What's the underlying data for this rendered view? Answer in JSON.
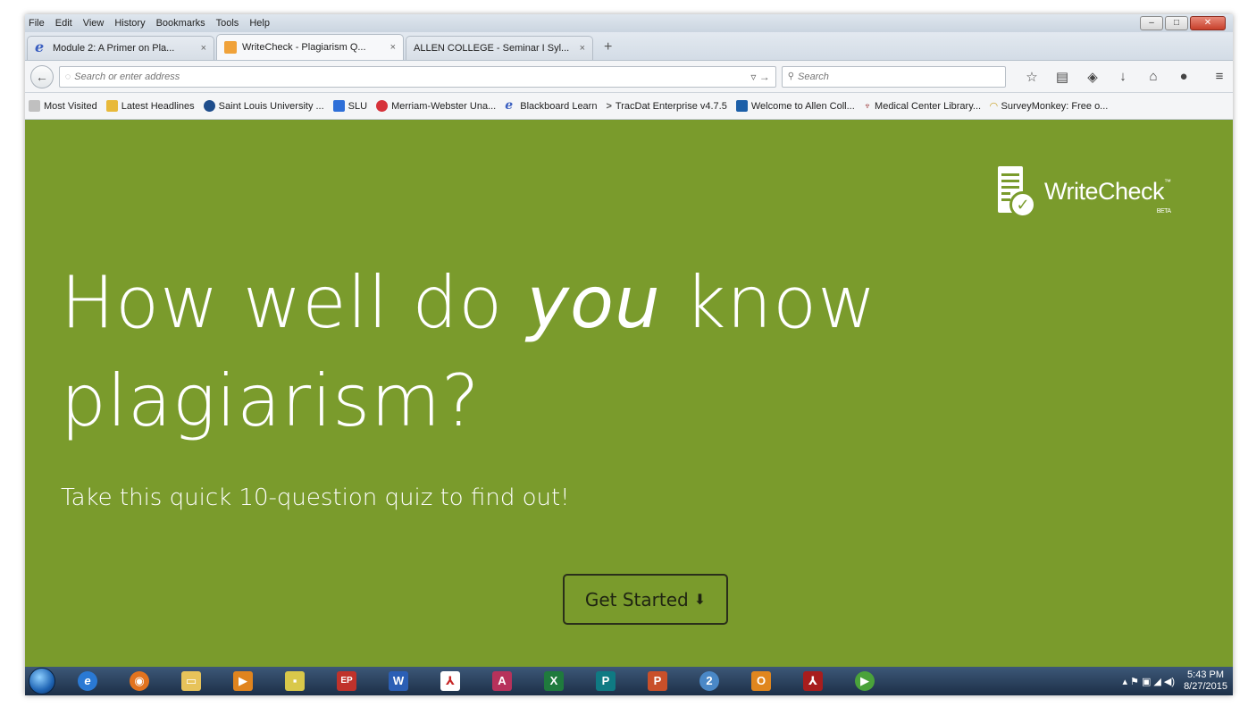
{
  "menubar": {
    "items": [
      "File",
      "Edit",
      "View",
      "History",
      "Bookmarks",
      "Tools",
      "Help"
    ]
  },
  "tabs": [
    {
      "label": "Module 2: A Primer on Pla...",
      "icon": "ie-icon"
    },
    {
      "label": "WriteCheck - Plagiarism Q...",
      "icon": "writecheck-icon"
    },
    {
      "label": "ALLEN COLLEGE - Seminar I Syl...",
      "icon": "none"
    }
  ],
  "newtab_label": "+",
  "tab_close": "×",
  "navbar": {
    "url_placeholder": "Search or enter address",
    "url_arrows": "▿ →",
    "search_placeholder": "Search",
    "search_glyph": "🔍"
  },
  "toolbar_icons": {
    "star": "☆",
    "reader": "▤",
    "pocket": "◈",
    "download": "↓",
    "home": "⌂",
    "chat": "●",
    "menu": "≡"
  },
  "bookmarks": [
    {
      "label": "Most Visited",
      "color": "#c0c0c0"
    },
    {
      "label": "Latest Headlines",
      "color": "#e8b93a"
    },
    {
      "label": "Saint Louis University ...",
      "color": "#1e4d8c"
    },
    {
      "label": "SLU",
      "color": "#2e6fd8"
    },
    {
      "label": "Merriam-Webster Una...",
      "color": "#d6323a"
    },
    {
      "label": "Blackboard Learn",
      "color": "#3b5fc0"
    },
    {
      "label": "TracDat Enterprise v4.7.5",
      "color": "#555555"
    },
    {
      "label": "Welcome to Allen Coll...",
      "color": "#1c5fa8"
    },
    {
      "label": "Medical Center Library...",
      "color": "#8c1b1b"
    },
    {
      "label": "SurveyMonkey: Free o...",
      "color": "#c9a227"
    }
  ],
  "page": {
    "logo_text": "WriteCheck",
    "logo_tm": "™",
    "logo_beta": "BETA",
    "headline_part1": "How well do ",
    "headline_em": "you",
    "headline_part2": " know",
    "headline_line2": "plagiarism?",
    "subtitle": "Take this quick 10-question quiz to find out!",
    "cta_label": "Get Started",
    "cta_arrow": "⬇",
    "background_color": "#7a9b2c"
  },
  "taskbar": {
    "apps": [
      {
        "name": "ie",
        "glyph": "e",
        "color": "#2a79d4"
      },
      {
        "name": "firefox",
        "glyph": "◉",
        "color": "#e2731f"
      },
      {
        "name": "explorer",
        "glyph": "▭",
        "color": "#e7c35a"
      },
      {
        "name": "media",
        "glyph": "▶",
        "color": "#e0841e"
      },
      {
        "name": "sticky",
        "glyph": "▪",
        "color": "#d9c84a"
      },
      {
        "name": "app-ep",
        "glyph": "EP",
        "color": "#c0322b"
      },
      {
        "name": "word",
        "glyph": "W",
        "color": "#2b5fb5"
      },
      {
        "name": "acrobat",
        "glyph": "⅄",
        "color": "#c72727"
      },
      {
        "name": "access",
        "glyph": "A",
        "color": "#b7325b"
      },
      {
        "name": "excel",
        "glyph": "X",
        "color": "#1f7a3d"
      },
      {
        "name": "publisher",
        "glyph": "P",
        "color": "#0f7a83"
      },
      {
        "name": "powerpoint",
        "glyph": "P",
        "color": "#c9502a"
      },
      {
        "name": "lync",
        "glyph": "2",
        "color": "#4a88c7"
      },
      {
        "name": "outlook",
        "glyph": "O",
        "color": "#e0861e"
      },
      {
        "name": "reader",
        "glyph": "⅄",
        "color": "#a81d1d"
      },
      {
        "name": "camtasia",
        "glyph": "▶",
        "color": "#4aa23a"
      }
    ],
    "tray_icons": "▴ ⚑ ▣ ◢ ◀)",
    "time": "5:43 PM",
    "date": "8/27/2015"
  }
}
